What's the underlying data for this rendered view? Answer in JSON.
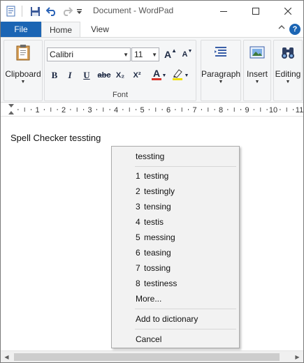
{
  "window": {
    "title": "Document - WordPad",
    "controls": [
      "minimize",
      "maximize",
      "close"
    ]
  },
  "quick_access": {
    "items": [
      {
        "name": "wordpad-app-icon"
      },
      {
        "name": "save-icon"
      },
      {
        "name": "undo-icon"
      },
      {
        "name": "redo-icon"
      },
      {
        "name": "customize-dropdown-icon"
      }
    ]
  },
  "tabs": {
    "file": "File",
    "home": "Home",
    "view": "View"
  },
  "ribbon": {
    "clipboard_label": "Clipboard",
    "font_group_label": "Font",
    "font_family": "Calibri",
    "font_size": "11",
    "bold": "B",
    "italic": "I",
    "underline": "U",
    "strike": "abc",
    "subscript": "X₂",
    "superscript": "X²",
    "font_color_label": "A",
    "paragraph_label": "Paragraph",
    "insert_label": "Insert",
    "editing_label": "Editing"
  },
  "ruler": {
    "labels": [
      "1",
      "2",
      "3",
      "4",
      "5",
      "6",
      "7",
      "8",
      "9",
      "10",
      "11"
    ]
  },
  "document": {
    "text": "Spell Checker tessting"
  },
  "context_menu": {
    "misspelled": "tessting",
    "suggestions": [
      {
        "num": "1",
        "word": "testing"
      },
      {
        "num": "2",
        "word": "testingly"
      },
      {
        "num": "3",
        "word": "tensing"
      },
      {
        "num": "4",
        "word": "testis"
      },
      {
        "num": "5",
        "word": "messing"
      },
      {
        "num": "6",
        "word": "teasing"
      },
      {
        "num": "7",
        "word": "tossing"
      },
      {
        "num": "8",
        "word": "testiness"
      }
    ],
    "more": "More...",
    "add_to_dictionary": "Add to dictionary",
    "cancel": "Cancel"
  },
  "colors": {
    "file_tab": "#1b65b4",
    "accent_blue": "#1b65b4",
    "font_color_bar": "#d9342b",
    "highlight_bar": "#f0e000"
  }
}
